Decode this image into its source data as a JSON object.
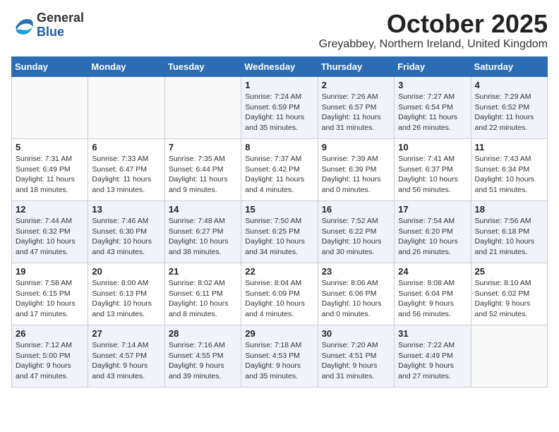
{
  "logo": {
    "general": "General",
    "blue": "Blue"
  },
  "title": "October 2025",
  "location": "Greyabbey, Northern Ireland, United Kingdom",
  "days_of_week": [
    "Sunday",
    "Monday",
    "Tuesday",
    "Wednesday",
    "Thursday",
    "Friday",
    "Saturday"
  ],
  "weeks": [
    [
      {
        "day": "",
        "info": ""
      },
      {
        "day": "",
        "info": ""
      },
      {
        "day": "",
        "info": ""
      },
      {
        "day": "1",
        "info": "Sunrise: 7:24 AM\nSunset: 6:59 PM\nDaylight: 11 hours\nand 35 minutes."
      },
      {
        "day": "2",
        "info": "Sunrise: 7:26 AM\nSunset: 6:57 PM\nDaylight: 11 hours\nand 31 minutes."
      },
      {
        "day": "3",
        "info": "Sunrise: 7:27 AM\nSunset: 6:54 PM\nDaylight: 11 hours\nand 26 minutes."
      },
      {
        "day": "4",
        "info": "Sunrise: 7:29 AM\nSunset: 6:52 PM\nDaylight: 11 hours\nand 22 minutes."
      }
    ],
    [
      {
        "day": "5",
        "info": "Sunrise: 7:31 AM\nSunset: 6:49 PM\nDaylight: 11 hours\nand 18 minutes."
      },
      {
        "day": "6",
        "info": "Sunrise: 7:33 AM\nSunset: 6:47 PM\nDaylight: 11 hours\nand 13 minutes."
      },
      {
        "day": "7",
        "info": "Sunrise: 7:35 AM\nSunset: 6:44 PM\nDaylight: 11 hours\nand 9 minutes."
      },
      {
        "day": "8",
        "info": "Sunrise: 7:37 AM\nSunset: 6:42 PM\nDaylight: 11 hours\nand 4 minutes."
      },
      {
        "day": "9",
        "info": "Sunrise: 7:39 AM\nSunset: 6:39 PM\nDaylight: 11 hours\nand 0 minutes."
      },
      {
        "day": "10",
        "info": "Sunrise: 7:41 AM\nSunset: 6:37 PM\nDaylight: 10 hours\nand 56 minutes."
      },
      {
        "day": "11",
        "info": "Sunrise: 7:43 AM\nSunset: 6:34 PM\nDaylight: 10 hours\nand 51 minutes."
      }
    ],
    [
      {
        "day": "12",
        "info": "Sunrise: 7:44 AM\nSunset: 6:32 PM\nDaylight: 10 hours\nand 47 minutes."
      },
      {
        "day": "13",
        "info": "Sunrise: 7:46 AM\nSunset: 6:30 PM\nDaylight: 10 hours\nand 43 minutes."
      },
      {
        "day": "14",
        "info": "Sunrise: 7:48 AM\nSunset: 6:27 PM\nDaylight: 10 hours\nand 38 minutes."
      },
      {
        "day": "15",
        "info": "Sunrise: 7:50 AM\nSunset: 6:25 PM\nDaylight: 10 hours\nand 34 minutes."
      },
      {
        "day": "16",
        "info": "Sunrise: 7:52 AM\nSunset: 6:22 PM\nDaylight: 10 hours\nand 30 minutes."
      },
      {
        "day": "17",
        "info": "Sunrise: 7:54 AM\nSunset: 6:20 PM\nDaylight: 10 hours\nand 26 minutes."
      },
      {
        "day": "18",
        "info": "Sunrise: 7:56 AM\nSunset: 6:18 PM\nDaylight: 10 hours\nand 21 minutes."
      }
    ],
    [
      {
        "day": "19",
        "info": "Sunrise: 7:58 AM\nSunset: 6:15 PM\nDaylight: 10 hours\nand 17 minutes."
      },
      {
        "day": "20",
        "info": "Sunrise: 8:00 AM\nSunset: 6:13 PM\nDaylight: 10 hours\nand 13 minutes."
      },
      {
        "day": "21",
        "info": "Sunrise: 8:02 AM\nSunset: 6:11 PM\nDaylight: 10 hours\nand 8 minutes."
      },
      {
        "day": "22",
        "info": "Sunrise: 8:04 AM\nSunset: 6:09 PM\nDaylight: 10 hours\nand 4 minutes."
      },
      {
        "day": "23",
        "info": "Sunrise: 8:06 AM\nSunset: 6:06 PM\nDaylight: 10 hours\nand 0 minutes."
      },
      {
        "day": "24",
        "info": "Sunrise: 8:08 AM\nSunset: 6:04 PM\nDaylight: 9 hours\nand 56 minutes."
      },
      {
        "day": "25",
        "info": "Sunrise: 8:10 AM\nSunset: 6:02 PM\nDaylight: 9 hours\nand 52 minutes."
      }
    ],
    [
      {
        "day": "26",
        "info": "Sunrise: 7:12 AM\nSunset: 5:00 PM\nDaylight: 9 hours\nand 47 minutes."
      },
      {
        "day": "27",
        "info": "Sunrise: 7:14 AM\nSunset: 4:57 PM\nDaylight: 9 hours\nand 43 minutes."
      },
      {
        "day": "28",
        "info": "Sunrise: 7:16 AM\nSunset: 4:55 PM\nDaylight: 9 hours\nand 39 minutes."
      },
      {
        "day": "29",
        "info": "Sunrise: 7:18 AM\nSunset: 4:53 PM\nDaylight: 9 hours\nand 35 minutes."
      },
      {
        "day": "30",
        "info": "Sunrise: 7:20 AM\nSunset: 4:51 PM\nDaylight: 9 hours\nand 31 minutes."
      },
      {
        "day": "31",
        "info": "Sunrise: 7:22 AM\nSunset: 4:49 PM\nDaylight: 9 hours\nand 27 minutes."
      },
      {
        "day": "",
        "info": ""
      }
    ]
  ]
}
